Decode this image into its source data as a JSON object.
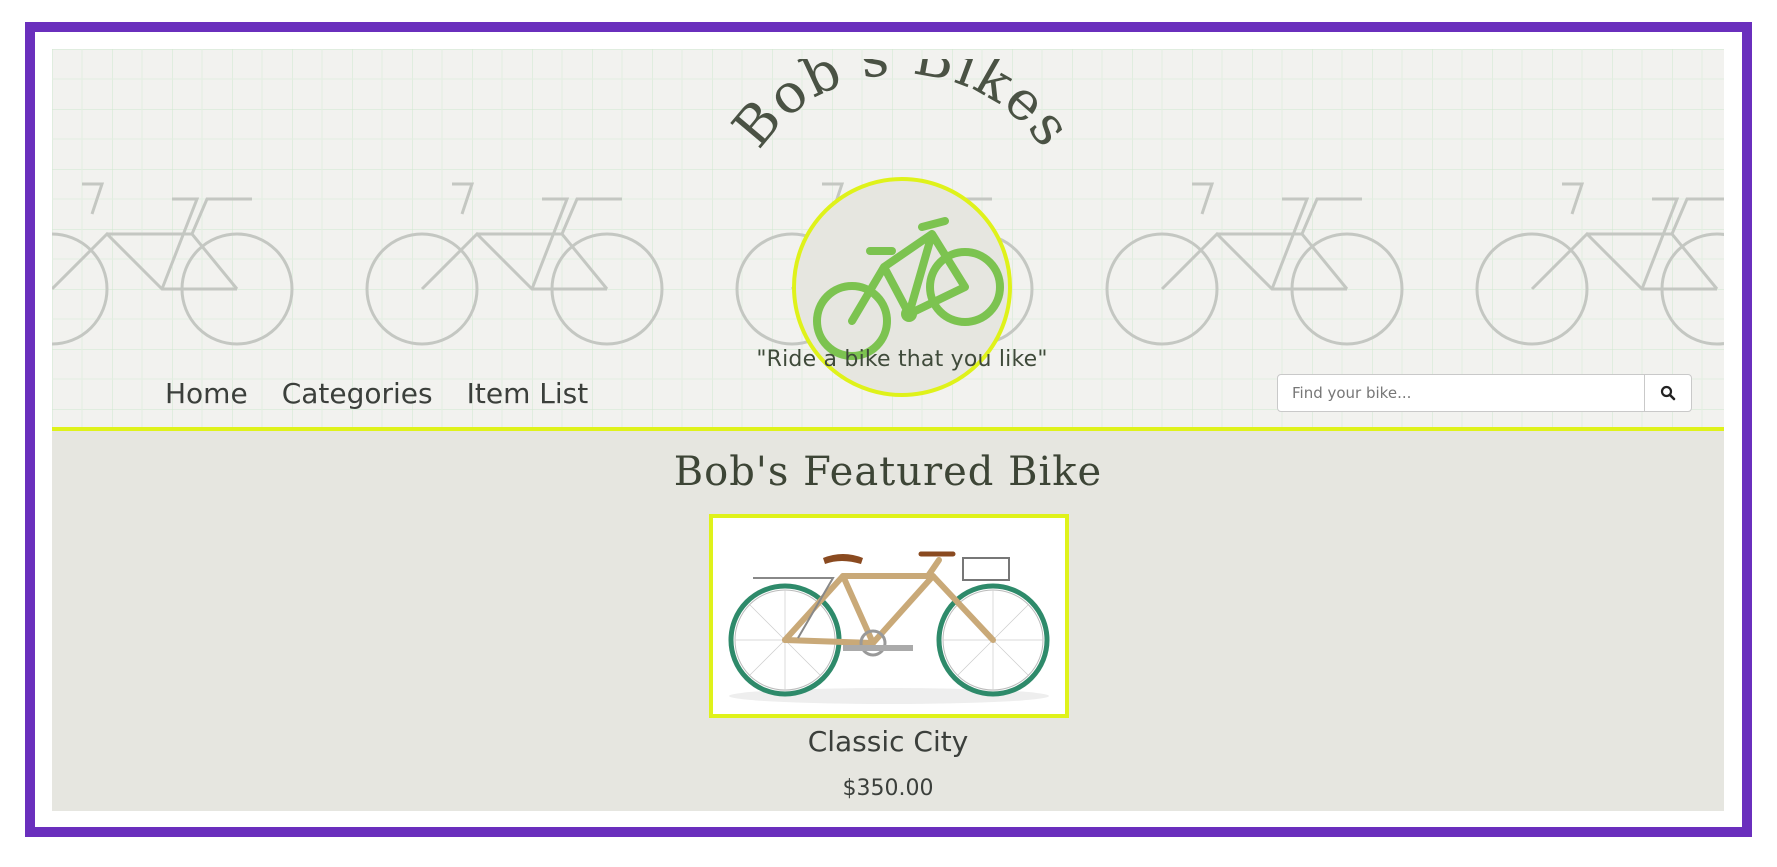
{
  "brand": {
    "name": "Bob's Bikes",
    "tagline": "\"Ride a bike that you like\""
  },
  "nav": {
    "items": [
      {
        "label": "Home"
      },
      {
        "label": "Categories"
      },
      {
        "label": "Item List"
      }
    ]
  },
  "search": {
    "placeholder": "Find your bike...",
    "icon": "search-icon"
  },
  "featured": {
    "title": "Bob's Featured Bike",
    "product_name": "Classic City",
    "price": "$350.00"
  },
  "colors": {
    "frame": "#6a2fbd",
    "accent": "#dff21a",
    "logo_green": "#7cc350",
    "text": "#3b3f3b"
  }
}
